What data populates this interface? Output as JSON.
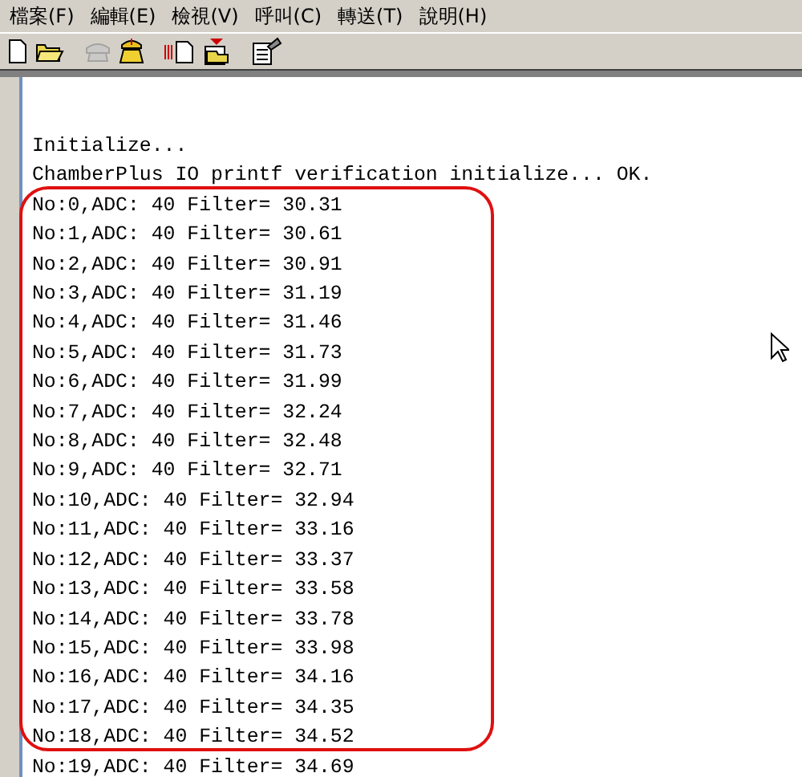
{
  "menu": [
    "檔案(F)",
    "編輯(E)",
    "檢視(V)",
    "呼叫(C)",
    "轉送(T)",
    "說明(H)"
  ],
  "toolbar": [
    {
      "kind": "new",
      "disabled": false
    },
    {
      "kind": "open",
      "disabled": false
    },
    {
      "kind": "disconnect",
      "disabled": true
    },
    {
      "kind": "call",
      "disabled": false
    },
    {
      "kind": "send",
      "disabled": false
    },
    {
      "kind": "receive",
      "disabled": false
    },
    {
      "kind": "properties",
      "disabled": false
    }
  ],
  "terminal": {
    "lines": [
      "Initialize...",
      "ChamberPlus IO printf verification initialize... OK.",
      "No:0,ADC: 40 Filter= 30.31",
      "No:1,ADC: 40 Filter= 30.61",
      "No:2,ADC: 40 Filter= 30.91",
      "No:3,ADC: 40 Filter= 31.19",
      "No:4,ADC: 40 Filter= 31.46",
      "No:5,ADC: 40 Filter= 31.73",
      "No:6,ADC: 40 Filter= 31.99",
      "No:7,ADC: 40 Filter= 32.24",
      "No:8,ADC: 40 Filter= 32.48",
      "No:9,ADC: 40 Filter= 32.71",
      "No:10,ADC: 40 Filter= 32.94",
      "No:11,ADC: 40 Filter= 33.16",
      "No:12,ADC: 40 Filter= 33.37",
      "No:13,ADC: 40 Filter= 33.58",
      "No:14,ADC: 40 Filter= 33.78",
      "No:15,ADC: 40 Filter= 33.98",
      "No:16,ADC: 40 Filter= 34.16",
      "No:17,ADC: 40 Filter= 34.35",
      "No:18,ADC: 40 Filter= 34.52",
      "No:19,ADC: 40 Filter= 34.69"
    ]
  }
}
